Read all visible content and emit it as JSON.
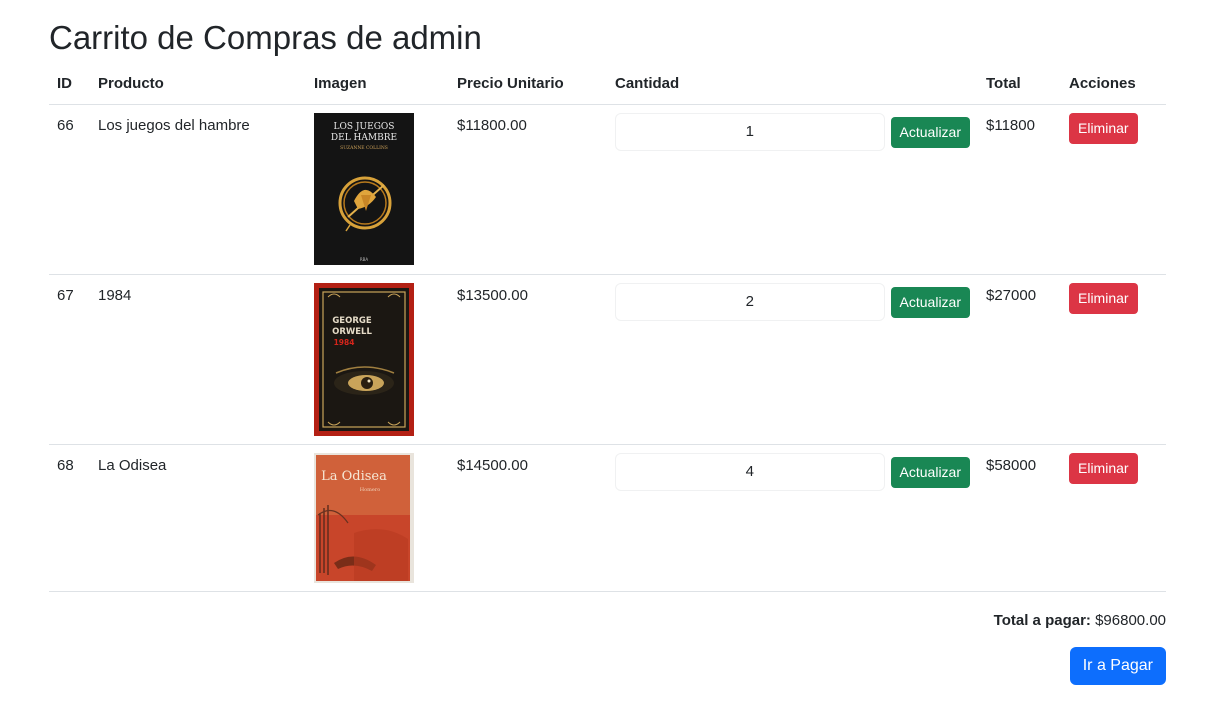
{
  "page": {
    "title": "Carrito de Compras de admin"
  },
  "table": {
    "headers": [
      "ID",
      "Producto",
      "Imagen",
      "Precio Unitario",
      "Cantidad",
      "Total",
      "Acciones"
    ],
    "rows": [
      {
        "id": "66",
        "product": "Los juegos del hambre",
        "price": "$11800.00",
        "quantity": "1",
        "total": "$11800",
        "update_label": "Actualizar",
        "delete_label": "Eliminar",
        "cover": {
          "line1": "LOS JUEGOS",
          "line2": "DEL HAMBRE",
          "author": "SUZANNE COLLINS"
        }
      },
      {
        "id": "67",
        "product": "1984",
        "price": "$13500.00",
        "quantity": "2",
        "total": "$27000",
        "update_label": "Actualizar",
        "delete_label": "Eliminar",
        "cover": {
          "line1": "GEORGE",
          "line2": "ORWELL",
          "line3": "1984"
        }
      },
      {
        "id": "68",
        "product": "La Odisea",
        "price": "$14500.00",
        "quantity": "4",
        "total": "$58000",
        "update_label": "Actualizar",
        "delete_label": "Eliminar",
        "cover": {
          "line1": "La Odisea",
          "line2": "Homero"
        }
      }
    ]
  },
  "summary": {
    "label": "Total a pagar:",
    "value": "$96800.00"
  },
  "pay_button": {
    "label": "Ir a Pagar"
  },
  "colors": {
    "success": "#198754",
    "danger": "#dc3545",
    "primary": "#0d6efd"
  }
}
